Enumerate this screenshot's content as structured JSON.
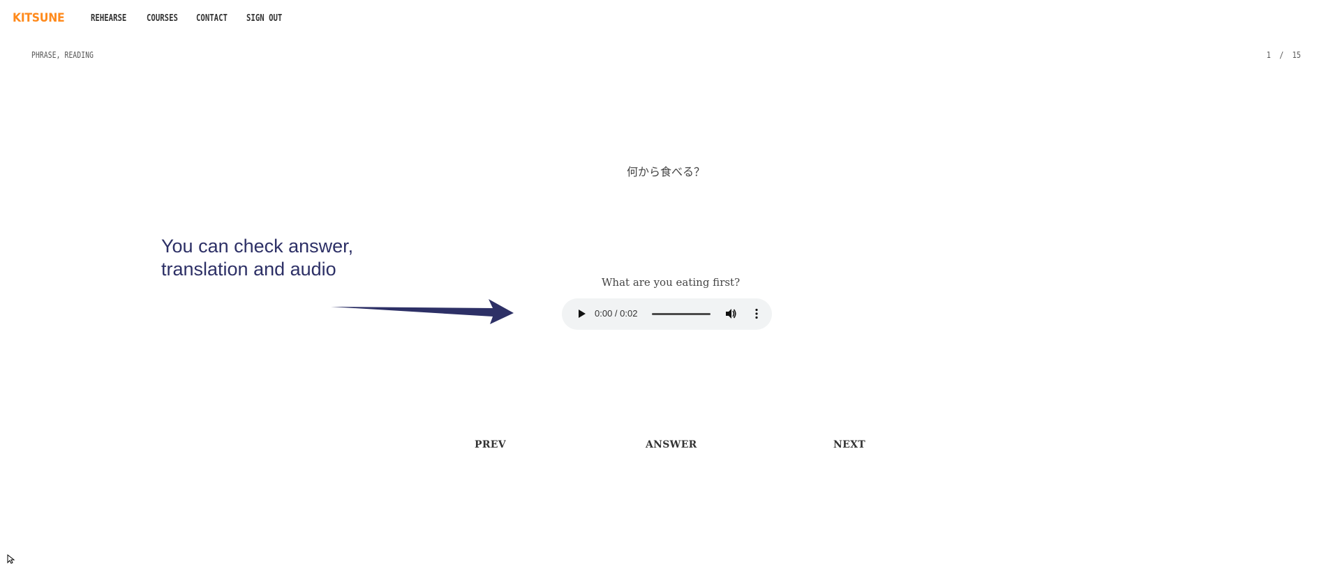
{
  "nav": {
    "brand": "KITSUNE",
    "brand_color": "#ff8a1c",
    "links": [
      "REHEARSE",
      "COURSES",
      "CONTACT",
      "SIGN OUT"
    ]
  },
  "card": {
    "category": "PHRASE, READING",
    "progress": "1  /  15",
    "phrase": "何から食べる？",
    "translation": "What are you eating first?"
  },
  "audio": {
    "time": "0:00 / 0:02",
    "icons": [
      "play-icon",
      "volume-icon",
      "more-options-icon"
    ]
  },
  "annotation": {
    "text_line1": "You can check answer,",
    "text_line2": "translation and audio",
    "color": "#2d3066"
  },
  "controls": {
    "prev": "PREV",
    "answer": "ANSWER",
    "next": "NEXT"
  }
}
